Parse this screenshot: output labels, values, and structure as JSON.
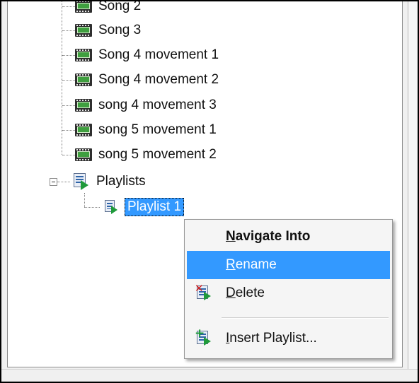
{
  "tree": {
    "songs": [
      {
        "label": "Song 2",
        "icon": "film-icon"
      },
      {
        "label": "Song 3",
        "icon": "film-icon"
      },
      {
        "label": "Song 4 movement 1",
        "icon": "film-icon"
      },
      {
        "label": "Song 4 movement 2",
        "icon": "film-icon"
      },
      {
        "label": "song 4 movement 3",
        "icon": "film-icon"
      },
      {
        "label": "song 5 movement 1",
        "icon": "film-icon"
      },
      {
        "label": "song 5 movement 2",
        "icon": "film-icon"
      }
    ],
    "playlists_node": {
      "label": "Playlists",
      "icon": "playlist-icon",
      "expanded": true
    },
    "playlist_items": [
      {
        "label": "Playlist 1",
        "icon": "playlist-icon",
        "selected": true
      }
    ]
  },
  "context_menu": {
    "items": [
      {
        "label": "Navigate Into",
        "mnemonic": "N",
        "bold": true,
        "highlighted": false,
        "icon": ""
      },
      {
        "label": "Rename",
        "mnemonic": "R",
        "bold": false,
        "highlighted": true,
        "icon": ""
      },
      {
        "label": "Delete",
        "mnemonic": "D",
        "bold": false,
        "highlighted": false,
        "icon": "delete-playlist-icon"
      },
      {
        "label": "Insert Playlist...",
        "mnemonic": "I",
        "bold": false,
        "highlighted": false,
        "icon": "insert-playlist-icon"
      }
    ]
  },
  "colors": {
    "selection": "#3399ff",
    "menu_background": "#f5f5f5",
    "tree_background": "#ffffff"
  }
}
